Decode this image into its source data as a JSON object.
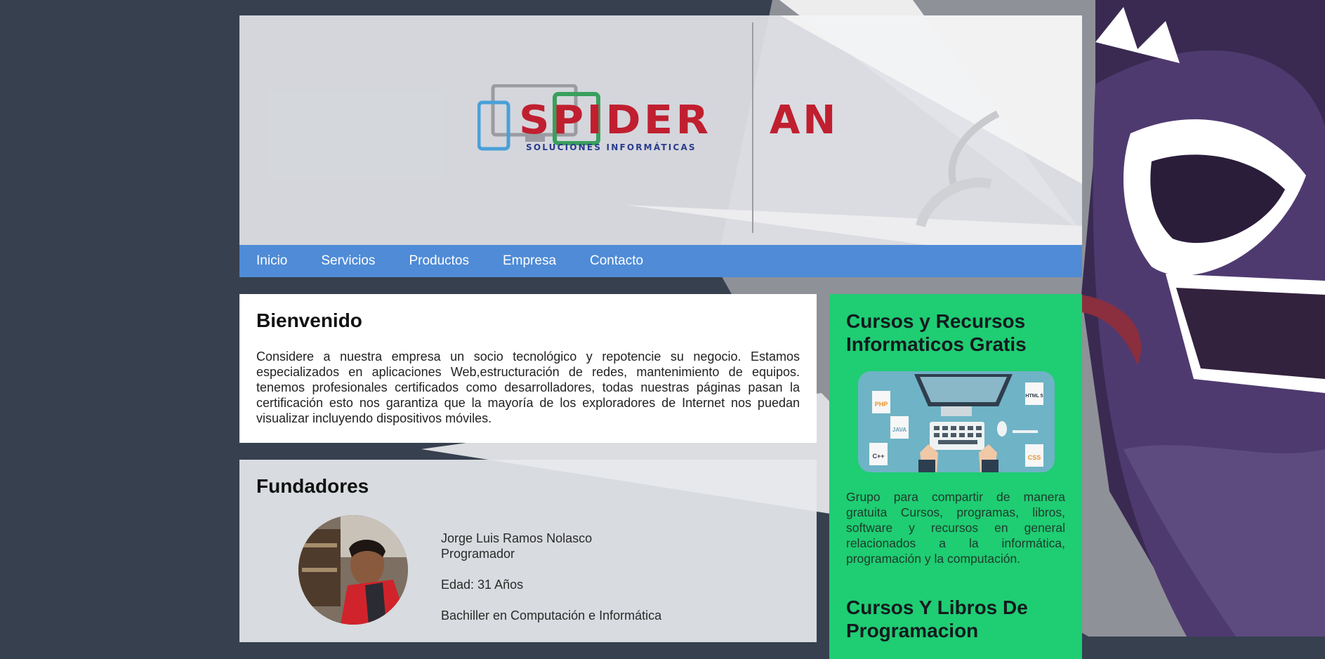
{
  "brand": {
    "logo_main": "SPIDER",
    "logo_tail": "AN",
    "logo_sub": "SOLUCIONES INFORMÁTICAS"
  },
  "nav": {
    "items": [
      {
        "label": "Inicio"
      },
      {
        "label": "Servicios"
      },
      {
        "label": "Productos"
      },
      {
        "label": "Empresa"
      },
      {
        "label": "Contacto"
      }
    ]
  },
  "welcome": {
    "title": "Bienvenido",
    "body": "Considere a nuestra empresa un socio tecnológico y repotencie su negocio. Estamos especializados en aplicaciones Web,estructuración de redes, mantenimiento de equipos. tenemos profesionales certificados como desarrolladores, todas nuestras páginas pasan la certificación esto nos garantiza que la mayoría de los exploradores de Internet nos puedan visualizar incluyendo dispositivos móviles."
  },
  "founders": {
    "title": "Fundadores",
    "person": {
      "name": "Jorge Luis Ramos Nolasco",
      "role": "Programador",
      "age": "Edad: 31 Años",
      "degree": "Bachiller en Computación e Informática"
    }
  },
  "sidebar": {
    "title": "Cursos y Recursos Informaticos Gratis",
    "icons": {
      "php": "PHP",
      "java": "JAVA",
      "cpp": "C++",
      "html": "HTML 5",
      "css": "CSS"
    },
    "description": "Grupo para compartir de manera gratuita Cursos, programas, libros, software y recursos en general relacionados a la informática, programación y la computación.",
    "second_title": "Cursos Y Libros De Programacion"
  },
  "colors": {
    "nav": "#4f8bd6",
    "sidebar": "#1fcd73",
    "logo_red": "#c01f2f",
    "background": "#36404f"
  }
}
